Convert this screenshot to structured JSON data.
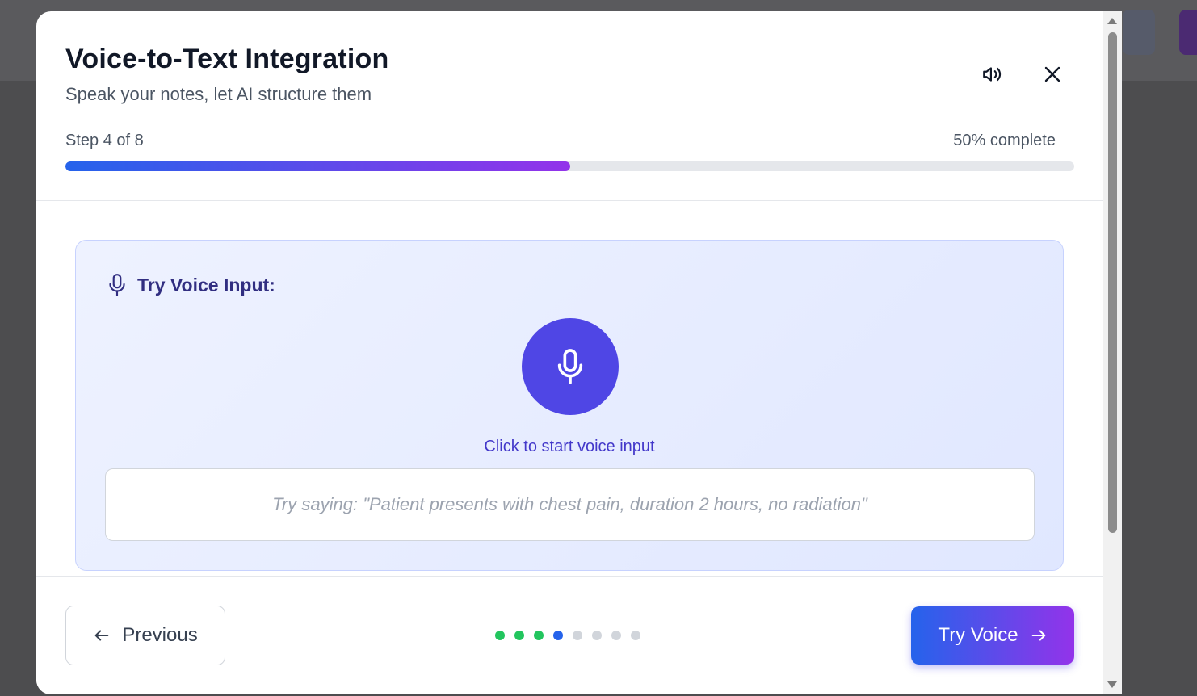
{
  "modal": {
    "title": "Voice-to-Text Integration",
    "subtitle": "Speak your notes, let AI structure them",
    "icons": {
      "sound": "speaker-icon",
      "close": "close-icon"
    }
  },
  "progress": {
    "step_label": "Step 4 of 8",
    "complete_label": "50% complete",
    "fill_fraction": 0.5
  },
  "voice_card": {
    "title": "Try Voice Input:",
    "icon": "microphone-icon",
    "mic_caption": "Click to start voice input",
    "transcript_placeholder": "Try saying: \"Patient presents with chest pain, duration 2 hours, no radiation\""
  },
  "footer": {
    "previous_label": "Previous",
    "next_label": "Try Voice",
    "steps": [
      {
        "state": "complete"
      },
      {
        "state": "complete"
      },
      {
        "state": "complete"
      },
      {
        "state": "current"
      },
      {
        "state": "pending"
      },
      {
        "state": "pending"
      },
      {
        "state": "pending"
      },
      {
        "state": "pending"
      }
    ]
  },
  "colors": {
    "accent": "#4f46e5",
    "gradient_start": "#2563eb",
    "gradient_end": "#9333ea",
    "dot_complete": "#22c55e",
    "dot_current": "#2563eb",
    "dot_pending": "#d1d5db"
  }
}
